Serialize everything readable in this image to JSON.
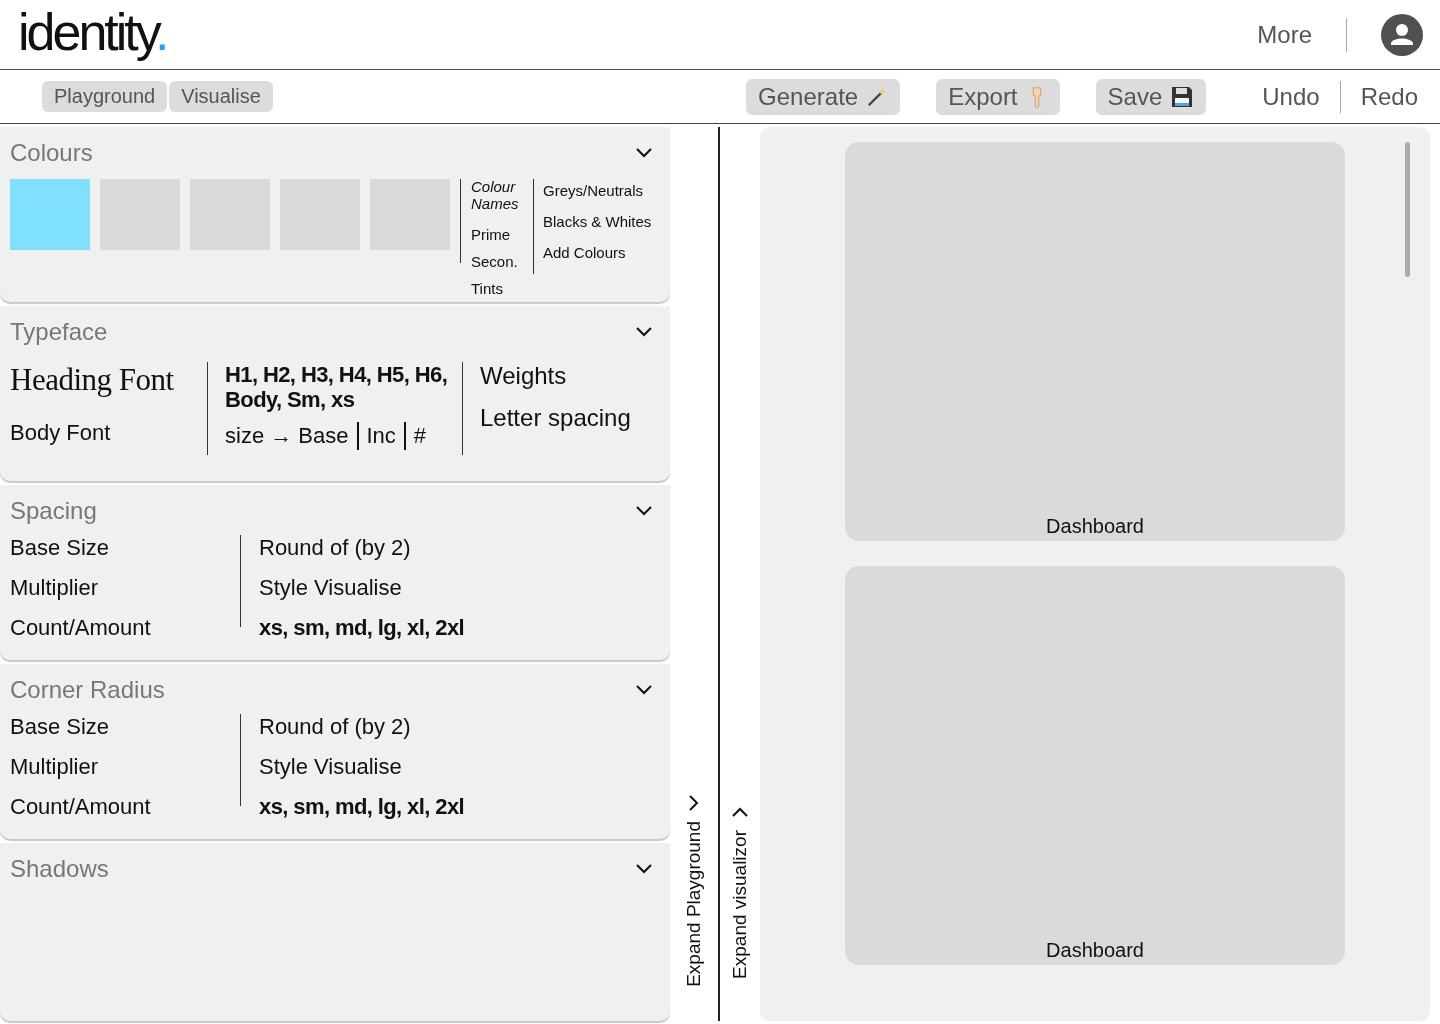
{
  "logo": {
    "word": "identity",
    "dot": "."
  },
  "more": "More",
  "tabs": [
    "Playground",
    "Visualise"
  ],
  "actions": [
    {
      "label": "Generate",
      "kind": "wand"
    },
    {
      "label": "Export",
      "kind": "hand"
    },
    {
      "label": "Save",
      "kind": "disk"
    }
  ],
  "history": [
    "Undo",
    "Redo"
  ],
  "sections": [
    {
      "kind": "colours",
      "title": "Colours",
      "expanded": true,
      "swatches": [
        {
          "color": "#80e0ff"
        },
        {
          "color": "#d9d9d9"
        },
        {
          "color": "#d9d9d9"
        },
        {
          "color": "#d9d9d9"
        },
        {
          "color": "#d9d9d9"
        }
      ],
      "names_heading": "Colour Names",
      "names": [
        "Prime",
        "Secon.",
        "Tints"
      ],
      "links": [
        "Greys/Neutrals",
        "Blacks & Whites",
        "Add Colours"
      ]
    },
    {
      "kind": "typeface",
      "title": "Typeface",
      "expanded": true,
      "heading_font": "Heading Font",
      "body_font": "Body Font",
      "levels": "H1, H2, H3, H4, H5, H6, Body, Sm, xs",
      "size_parts": [
        "size → Base",
        "Inc",
        "#"
      ],
      "options": [
        "Weights",
        "Letter spacing"
      ]
    },
    {
      "kind": "scale",
      "title": "Spacing",
      "expanded": true,
      "left": [
        "Base Size",
        "Multiplier",
        "Count/Amount"
      ],
      "right": [
        "Round of (by 2)",
        "Style Visualise"
      ],
      "sizes": "xs, sm, md, lg, xl, 2xl"
    },
    {
      "kind": "scale",
      "title": "Corner Radius",
      "expanded": true,
      "left": [
        "Base Size",
        "Multiplier",
        "Count/Amount"
      ],
      "right": [
        "Round of (by 2)",
        "Style Visualise"
      ],
      "sizes": "xs, sm, md, lg, xl, 2xl"
    },
    {
      "kind": "empty",
      "title": "Shadows",
      "expanded": true
    }
  ],
  "expand_playground": "Expand Playground",
  "expand_visualizer": "Expand visualizor",
  "previews": [
    {
      "label": "Dashboard"
    },
    {
      "label": "Dashboard"
    }
  ]
}
